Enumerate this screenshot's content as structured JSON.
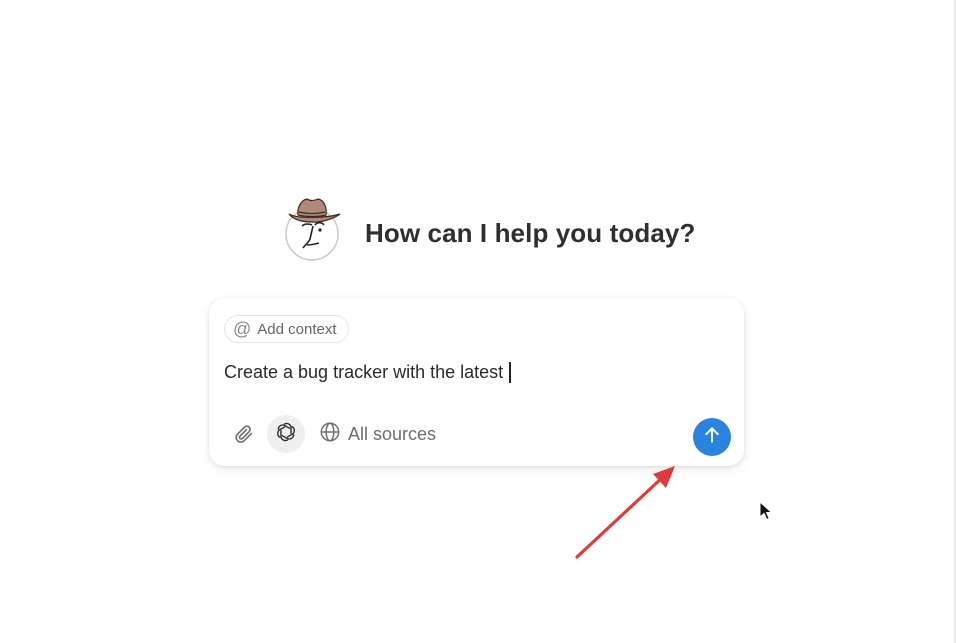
{
  "greeting": {
    "title": "How can I help you today?"
  },
  "composer": {
    "context_chip_label": "Add context",
    "prompt_text": "Create a bug tracker with the latest",
    "sources_label": "All sources"
  },
  "icons": {
    "context": "at-sign-icon",
    "attach": "paperclip-icon",
    "model": "openai-logo-icon",
    "sources": "globe-icon",
    "send": "arrow-up-icon"
  },
  "colors": {
    "send_button": "#2a83dd",
    "annotation_arrow": "#e03a3a",
    "title_text": "#2f2f2f"
  }
}
